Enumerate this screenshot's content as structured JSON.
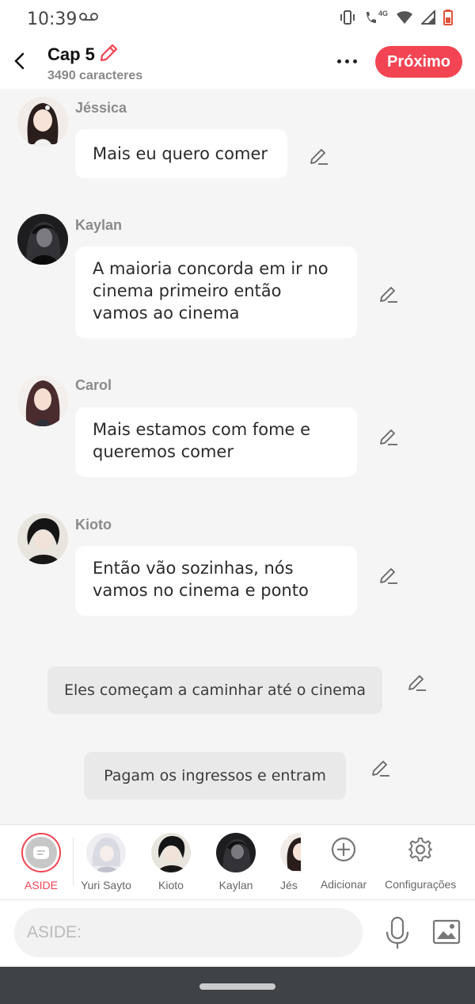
{
  "status_bar": {
    "time": "10:39",
    "network_label": "4G"
  },
  "header": {
    "title": "Cap 5",
    "char_count": "3490 caracteres",
    "next_label": "Próximo"
  },
  "colors": {
    "accent": "#f24452",
    "bubble": "#ffffff",
    "narration": "#e9e9e9",
    "background": "#f5f5f5"
  },
  "messages": [
    {
      "sender": "Jéssica",
      "text": "Mais eu quero comer"
    },
    {
      "sender": "Kaylan",
      "text": "A maioria concorda em ir no cinema primeiro então vamos ao cinema"
    },
    {
      "sender": "Carol",
      "text": "Mais estamos com fome e queremos comer"
    },
    {
      "sender": "Kioto",
      "text": "Então vão sozinhas, nós vamos no cinema e ponto"
    }
  ],
  "narrations": [
    {
      "text": "Eles começam a caminhar até o cinema"
    },
    {
      "text": "Pagam os ingressos e entram"
    }
  ],
  "characters": [
    {
      "label": "ASIDE"
    },
    {
      "label": "Yuri Sayto"
    },
    {
      "label": "Kioto"
    },
    {
      "label": "Kaylan"
    },
    {
      "label": "Jés"
    }
  ],
  "actions": {
    "add_label": "Adicionar",
    "settings_label": "Configurações"
  },
  "input": {
    "placeholder": "ASIDE:"
  }
}
